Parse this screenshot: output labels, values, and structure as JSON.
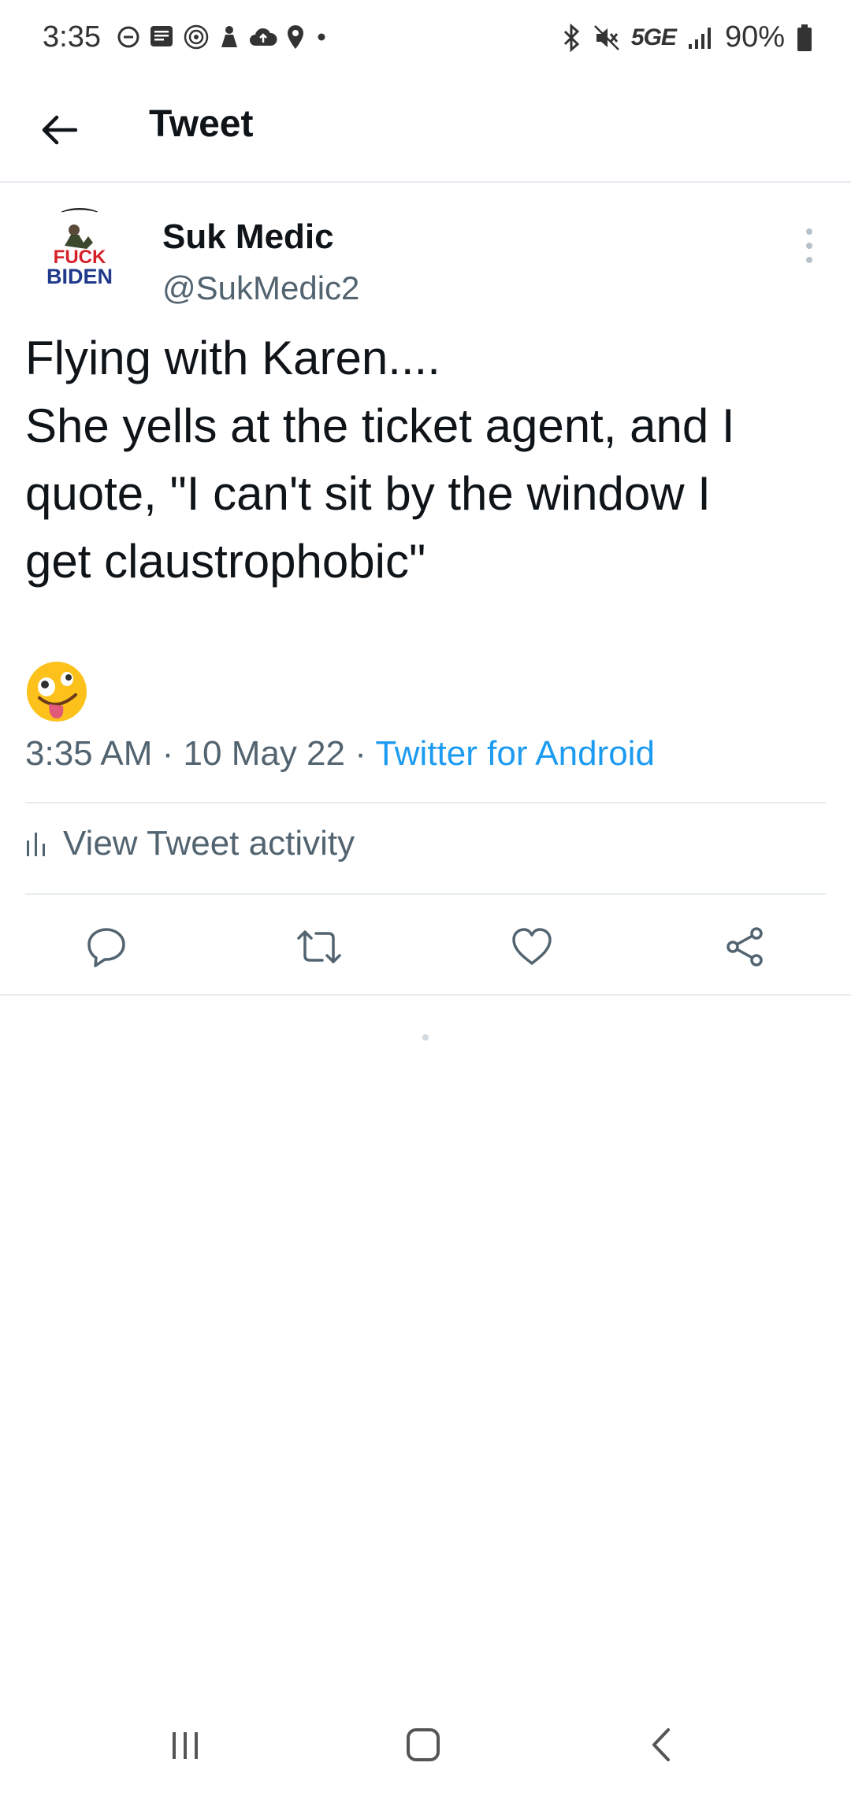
{
  "status_bar": {
    "time": "3:35",
    "network": "5GE",
    "battery": "90%"
  },
  "header": {
    "title": "Tweet"
  },
  "tweet": {
    "author_name": "Suk Medic",
    "author_handle": "@SukMedic2",
    "avatar_text_top": "FUCK",
    "avatar_text_bottom": "BIDEN",
    "text_lines": [
      "Flying with Karen....",
      "She yells at the ticket agent, and I",
      "quote, \"I can't sit by the window I",
      "get claustrophobic\""
    ],
    "emoji": "zany-face-emoji",
    "time": "3:35 AM",
    "date": "10 May 22",
    "separator": " · ",
    "source": "Twitter for Android",
    "activity_label": "View Tweet activity"
  },
  "colors": {
    "accent": "#1d9bf0",
    "secondary_text": "#536471",
    "divider": "#e6ecf0"
  }
}
